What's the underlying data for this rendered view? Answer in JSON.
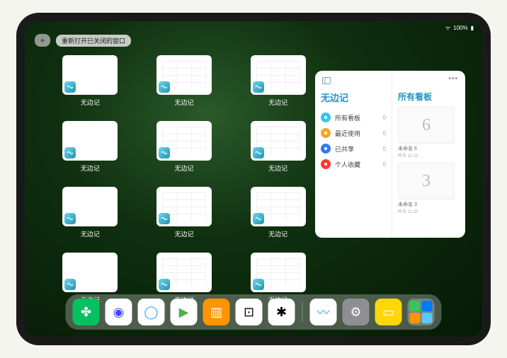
{
  "statusbar": {
    "wifi": "⋮⋮",
    "battery": "100%"
  },
  "topbar": {
    "plus": "+",
    "reopen_label": "重新打开已关闭的窗口"
  },
  "app_name": "无边记",
  "switcher": {
    "items": [
      {
        "label": "无边记",
        "gridded": false
      },
      {
        "label": "无边记",
        "gridded": true
      },
      {
        "label": "无边记",
        "gridded": true
      },
      {
        "label": "无边记",
        "gridded": false
      },
      {
        "label": "无边记",
        "gridded": true
      },
      {
        "label": "无边记",
        "gridded": true
      },
      {
        "label": "无边记",
        "gridded": false
      },
      {
        "label": "无边记",
        "gridded": true
      },
      {
        "label": "无边记",
        "gridded": true
      },
      {
        "label": "无边记",
        "gridded": false
      },
      {
        "label": "无边记",
        "gridded": true
      },
      {
        "label": "无边记",
        "gridded": true
      }
    ]
  },
  "panel": {
    "title": "无边记",
    "right_title": "所有看板",
    "more": "•••",
    "items": [
      {
        "label": "所有看板",
        "count": "0",
        "color": "#34c6eb"
      },
      {
        "label": "最近使用",
        "count": "0",
        "color": "#f5a623"
      },
      {
        "label": "已共享",
        "count": "0",
        "color": "#3478f6"
      },
      {
        "label": "个人收藏",
        "count": "0",
        "color": "#ff3b30"
      }
    ],
    "boards": [
      {
        "glyph": "6",
        "label": "未命名 6",
        "sub": "昨天 11:23"
      },
      {
        "glyph": "3",
        "label": "未命名 3",
        "sub": "昨天 11:20"
      }
    ]
  },
  "dock": {
    "icons": [
      {
        "name": "wechat",
        "bg": "#07c160",
        "glyph": "✤"
      },
      {
        "name": "quark",
        "bg": "#ffffff",
        "glyph": "◉",
        "fg": "#3a49ff"
      },
      {
        "name": "qqbrowser",
        "bg": "#ffffff",
        "glyph": "◯",
        "fg": "#2aa9ff"
      },
      {
        "name": "play",
        "bg": "#ffffff",
        "glyph": "▶",
        "fg": "#4caf50"
      },
      {
        "name": "books",
        "bg": "#ff9500",
        "glyph": "▥"
      },
      {
        "name": "dice",
        "bg": "#ffffff",
        "glyph": "⊡",
        "fg": "#000"
      },
      {
        "name": "connect",
        "bg": "#ffffff",
        "glyph": "✱",
        "fg": "#000"
      }
    ],
    "recent": [
      {
        "name": "freeform",
        "bg": "#ffffff",
        "glyph": "〰",
        "fg": "#30b0c7"
      },
      {
        "name": "settings",
        "bg": "#8e8e93",
        "glyph": "⚙"
      },
      {
        "name": "notes",
        "bg": "#ffd60a",
        "glyph": "▭"
      }
    ]
  }
}
